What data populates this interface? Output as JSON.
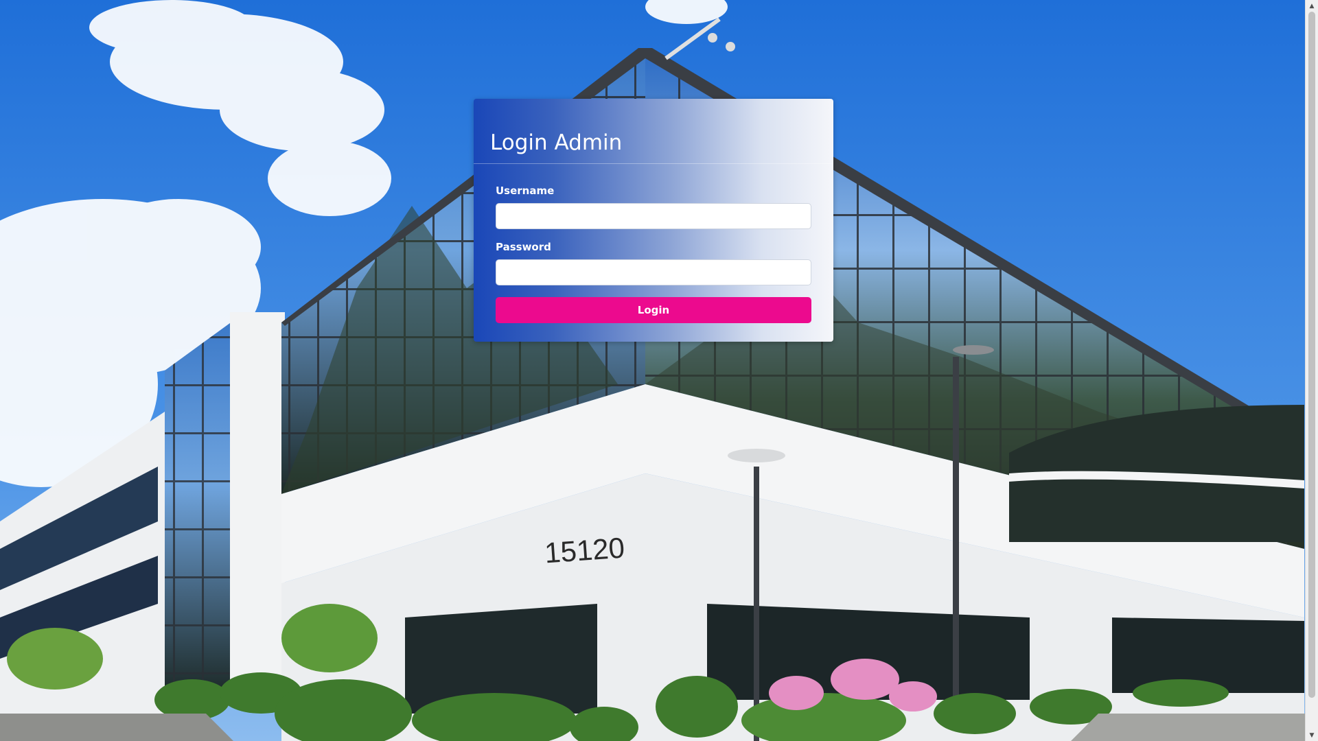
{
  "login": {
    "title": "Login Admin",
    "username_label": "Username",
    "username_value": "",
    "password_label": "Password",
    "password_value": "",
    "submit_label": "Login"
  },
  "background": {
    "building_number": "15120"
  },
  "colors": {
    "card_gradient_start": "#1a47b8",
    "card_gradient_end": "#f5f6fa",
    "login_button": "#ec0a8e",
    "sky": "#2f7de0"
  }
}
